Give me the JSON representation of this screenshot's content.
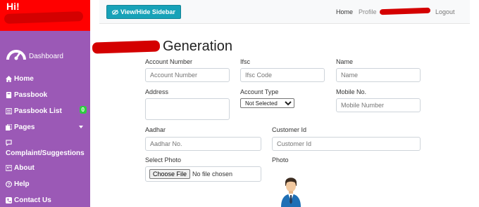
{
  "sidebar": {
    "greeting": "Hi!",
    "dashboard_label": "Dashboard",
    "items": [
      {
        "label": "Home",
        "icon": "home-icon"
      },
      {
        "label": "Passbook",
        "icon": "book-icon"
      },
      {
        "label": "Passbook List",
        "icon": "list-icon",
        "badge": "0"
      },
      {
        "label": "Pages",
        "icon": "pages-icon"
      },
      {
        "label": "Complaint/Suggestions",
        "icon": "chat-icon"
      },
      {
        "label": "About",
        "icon": "address-card-icon"
      },
      {
        "label": "Help",
        "icon": "question-icon"
      },
      {
        "label": "Contact Us",
        "icon": "phone-icon"
      }
    ]
  },
  "topbar": {
    "toggle_label": "View/Hide Sidebar",
    "nav": {
      "home": "Home",
      "profile": "Profile",
      "logout": "Logout"
    }
  },
  "page": {
    "title": "Generation"
  },
  "form": {
    "account_number": {
      "label": "Account Number",
      "placeholder": "Account Number"
    },
    "ifsc": {
      "label": "Ifsc",
      "placeholder": "Ifsc Code"
    },
    "name": {
      "label": "Name",
      "placeholder": "Name"
    },
    "address": {
      "label": "Address"
    },
    "account_type": {
      "label": "Account Type",
      "selected": "Not Selected"
    },
    "mobile": {
      "label": "Mobile No.",
      "placeholder": "Mobile Number"
    },
    "aadhar": {
      "label": "Aadhar",
      "placeholder": "Aadhar No."
    },
    "customer_id": {
      "label": "Customer Id",
      "placeholder": "Customer Id"
    },
    "photo_upload": {
      "label": "Select Photo",
      "button": "Choose File",
      "status": "No file chosen"
    },
    "photo_preview": {
      "label": "Photo"
    }
  },
  "colors": {
    "sidebar_bg": "#9b59b6",
    "sidebar_header_bg": "#ff0000",
    "button_accent": "#17a2b8",
    "badge": "#2ecc40"
  }
}
